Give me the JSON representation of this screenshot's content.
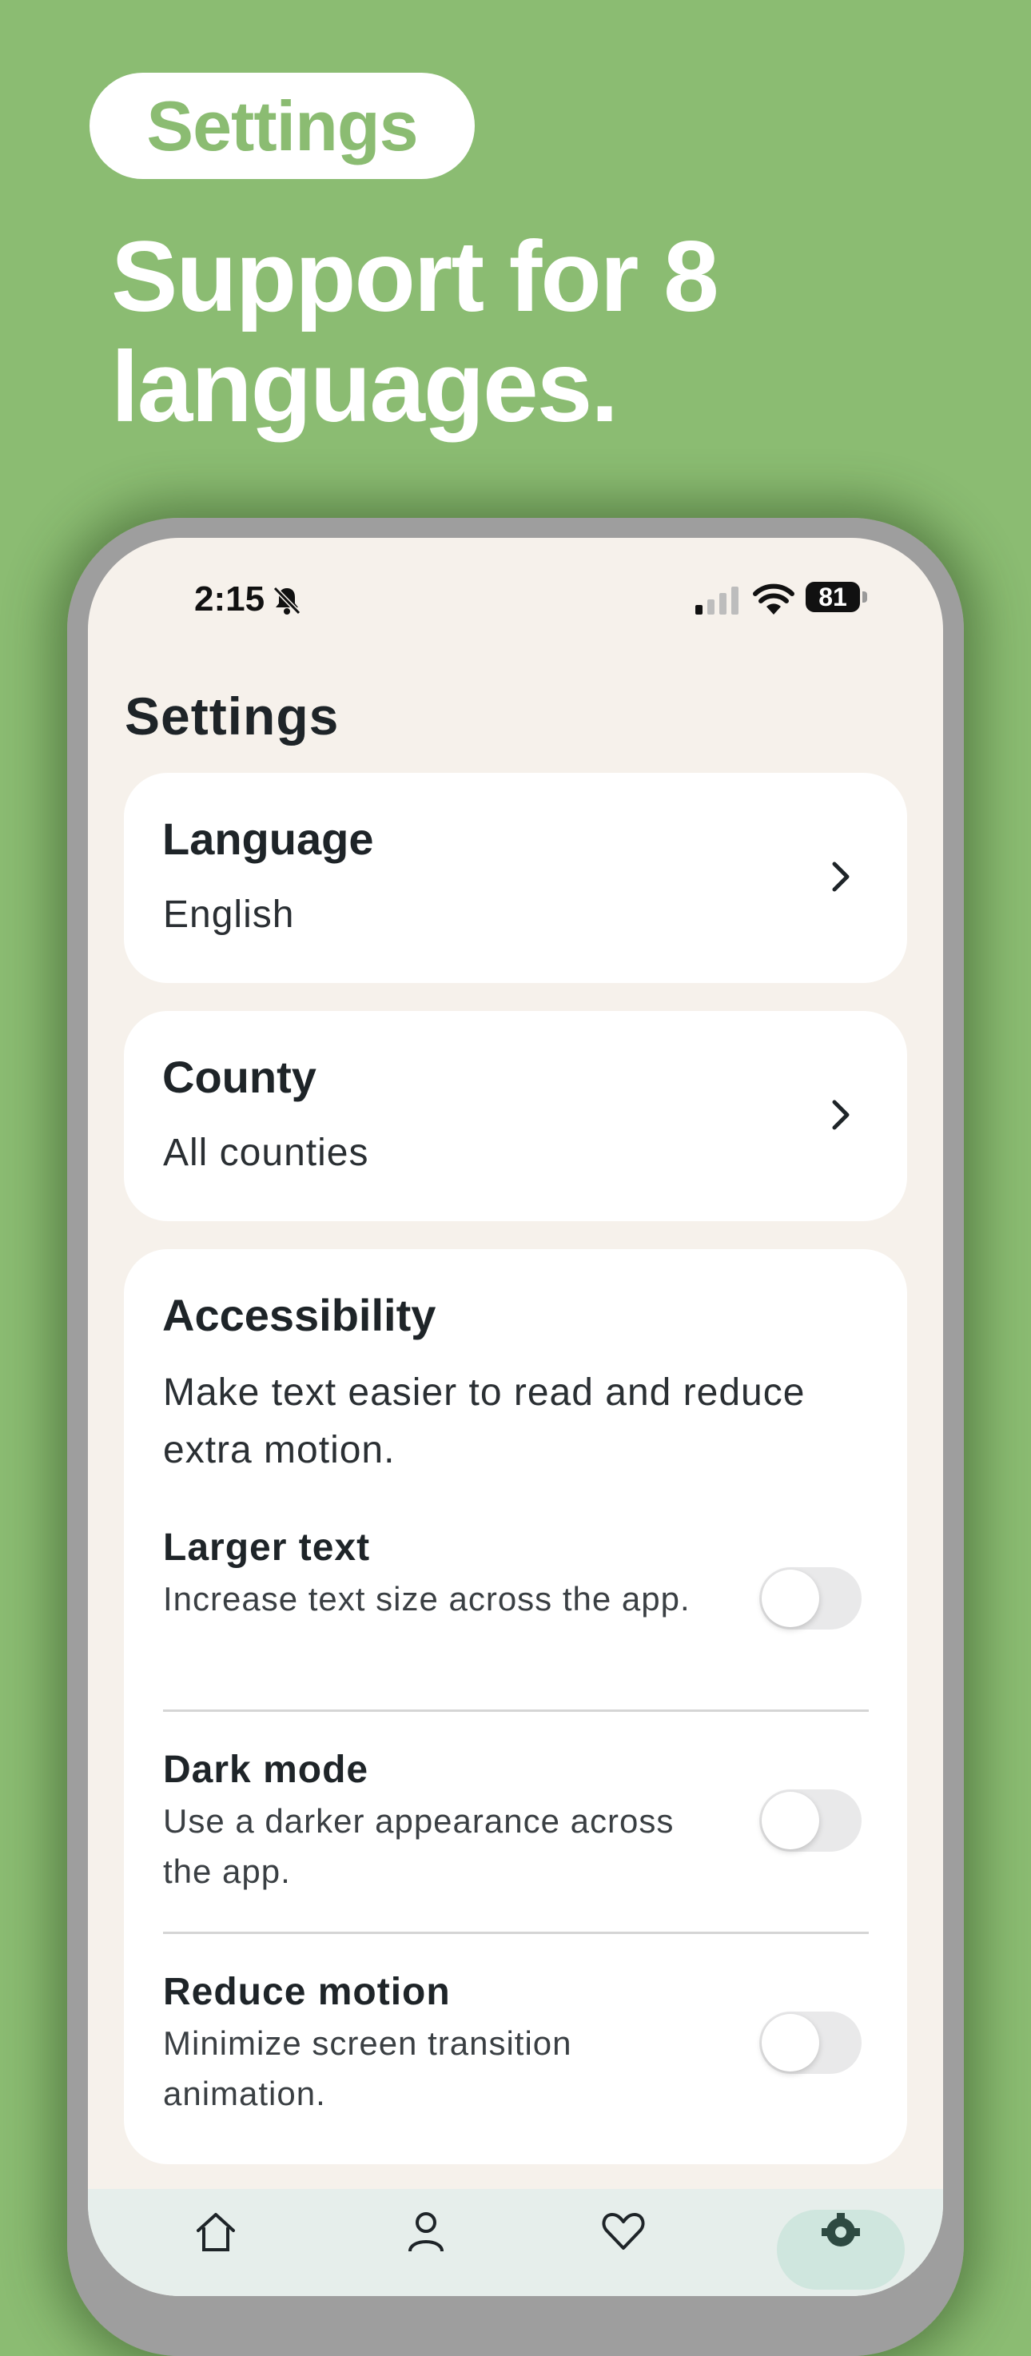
{
  "promo": {
    "pill_label": "Settings",
    "headline": "Support for 8 languages."
  },
  "status_bar": {
    "time": "2:15",
    "battery": "81"
  },
  "screen": {
    "title": "Settings"
  },
  "language_card": {
    "title": "Language",
    "value": "English"
  },
  "county_card": {
    "title": "County",
    "value": "All counties"
  },
  "accessibility": {
    "title": "Accessibility",
    "description": "Make text easier to read and reduce extra motion.",
    "settings": [
      {
        "title": "Larger text",
        "description": "Increase text size across the app.",
        "enabled": false
      },
      {
        "title": "Dark mode",
        "description": "Use a darker appearance across the app.",
        "enabled": false
      },
      {
        "title": "Reduce motion",
        "description": "Minimize screen transition animation.",
        "enabled": false
      }
    ]
  },
  "tab_bar": {
    "tabs": [
      {
        "icon": "home-icon",
        "active": false
      },
      {
        "icon": "person-icon",
        "active": false
      },
      {
        "icon": "heart-icon",
        "active": false
      },
      {
        "icon": "gear-icon",
        "active": true
      }
    ]
  },
  "colors": {
    "background": "#8BBC72",
    "screen": "#F6F1EB",
    "card": "#FFFFFF",
    "text": "#1E2428"
  }
}
